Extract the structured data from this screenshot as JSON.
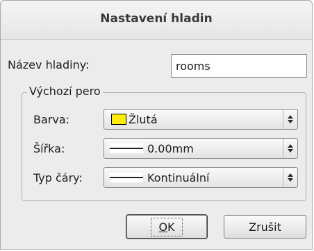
{
  "dialog": {
    "title": "Nastavení hladin",
    "layer_name": {
      "label": "Název hladiny:",
      "value": "rooms"
    },
    "default_pen": {
      "group_title": "Výchozí pero",
      "color": {
        "label": "Barva:",
        "value": "Žlutá",
        "swatch_color": "#ffee00"
      },
      "width": {
        "label": "Šířka:",
        "value": "0.00mm"
      },
      "line_type": {
        "label": "Typ čáry:",
        "value": "Kontinuální"
      }
    },
    "buttons": {
      "ok_mnemonic": "O",
      "ok_rest": "K",
      "cancel": "Zrušit"
    }
  }
}
